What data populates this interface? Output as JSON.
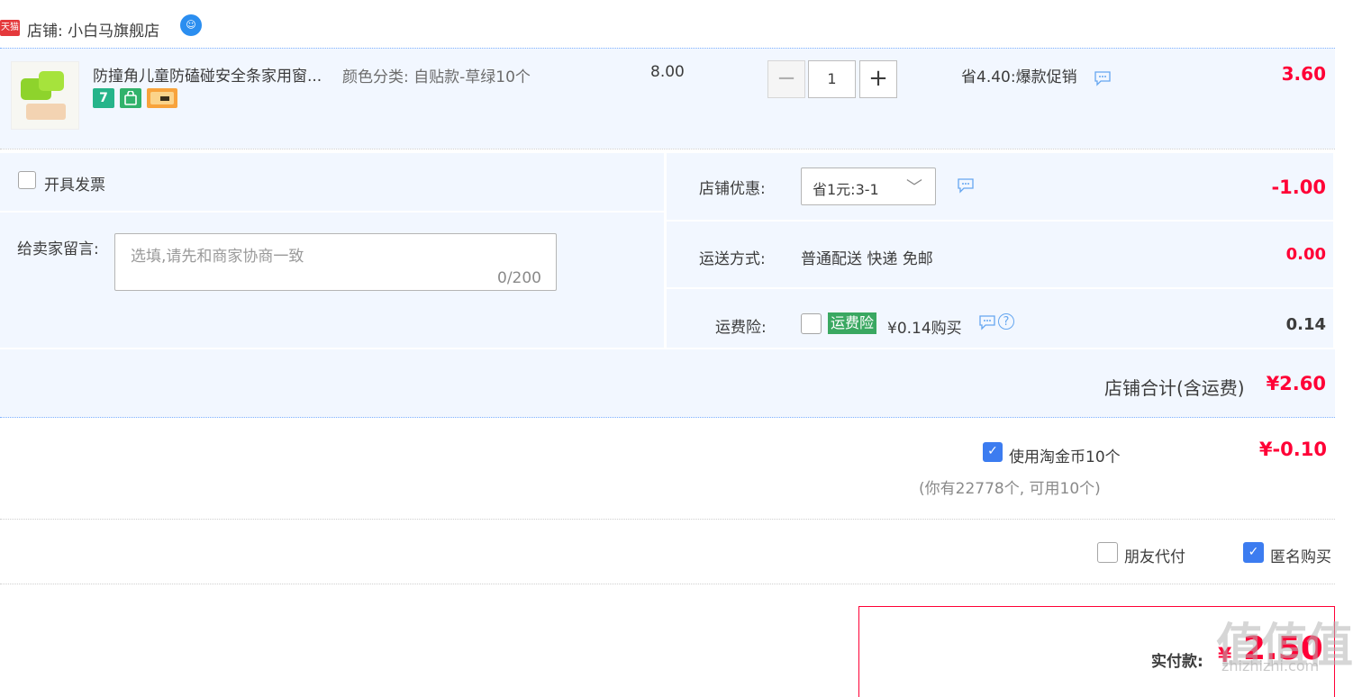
{
  "store": {
    "badge": "天猫",
    "label": "店铺:",
    "name": "小白马旗舰店",
    "ww_icon": "wangwang-chat-icon"
  },
  "item": {
    "title": "防撞角儿童防磕碰安全条家用窗...",
    "sku_label": "颜色分类:",
    "sku_value": "自贴款-草绿10个",
    "service_icons": [
      "7",
      "⑥",
      ""
    ],
    "unit_price": "8.00",
    "quantity": "1",
    "qty_minus": "−",
    "qty_plus": "+",
    "promo": "省4.40:爆款促销",
    "total": "3.60"
  },
  "invoice": {
    "label": "开具发票",
    "checked": false
  },
  "message": {
    "label": "给卖家留言:",
    "placeholder": "选填,请先和商家协商一致",
    "counter": "0/200"
  },
  "discount": {
    "label": "店铺优惠:",
    "selected": "省1元:3-1",
    "chevron": "﹀",
    "amount": "-1.00"
  },
  "shipping": {
    "label": "运送方式:",
    "method": "普通配送 快递 免邮",
    "amount": "0.00"
  },
  "insurance": {
    "label": "运费险:",
    "tag": "运费险",
    "price_text": "¥0.14购买",
    "help": "?",
    "amount": "0.14"
  },
  "subtotal": {
    "label": "店铺合计(含运费)",
    "amount": "¥2.60"
  },
  "coins": {
    "label": "使用淘金币10个",
    "checked": true,
    "note": "(你有22778个, 可用10个)",
    "amount": "¥-0.10"
  },
  "options": {
    "friend_pay": "朋友代付",
    "friend_pay_checked": false,
    "anonymous": "匿名购买",
    "anonymous_checked": true
  },
  "payment": {
    "label": "实付款:",
    "currency": "¥",
    "amount": "2.50"
  },
  "watermark": {
    "main": "值值值",
    "sub": "zhizhizhi.com"
  },
  "colors": {
    "accent_red": "#ff0036",
    "panel_blue": "#f2f7ff",
    "check_blue": "#3c7cf0"
  }
}
